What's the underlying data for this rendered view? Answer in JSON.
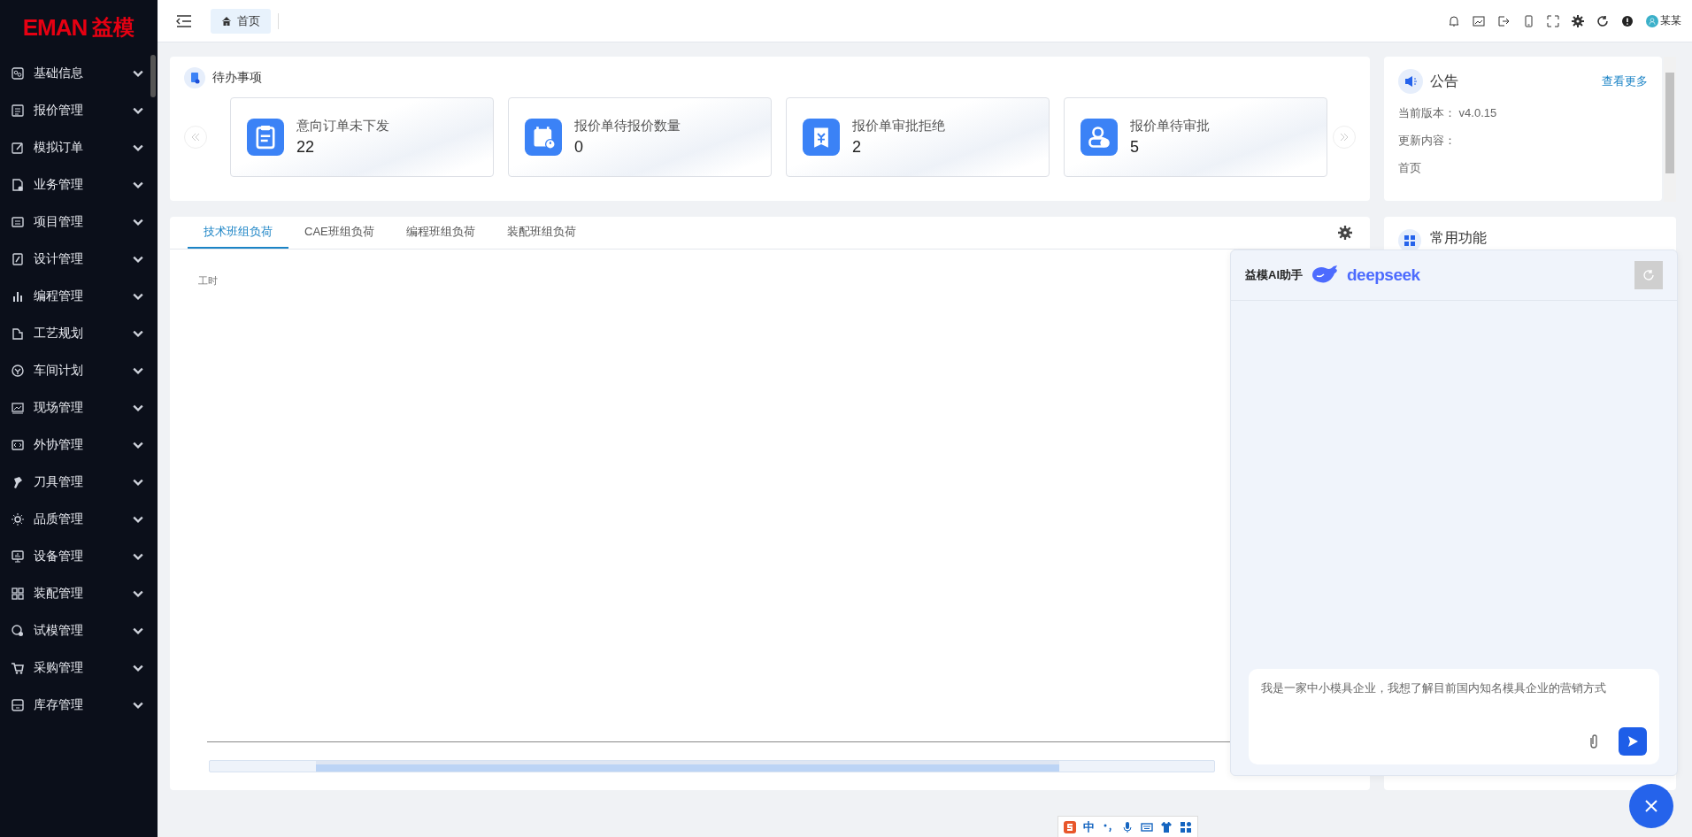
{
  "logo": {
    "latin": "EMAN",
    "cn": "益模"
  },
  "sidebar": {
    "items": [
      {
        "label": "基础信息"
      },
      {
        "label": "报价管理"
      },
      {
        "label": "模拟订单"
      },
      {
        "label": "业务管理"
      },
      {
        "label": "项目管理"
      },
      {
        "label": "设计管理"
      },
      {
        "label": "编程管理"
      },
      {
        "label": "工艺规划"
      },
      {
        "label": "车间计划"
      },
      {
        "label": "现场管理"
      },
      {
        "label": "外协管理"
      },
      {
        "label": "刀具管理"
      },
      {
        "label": "品质管理"
      },
      {
        "label": "设备管理"
      },
      {
        "label": "装配管理"
      },
      {
        "label": "试模管理"
      },
      {
        "label": "采购管理"
      },
      {
        "label": "库存管理"
      }
    ]
  },
  "topbar": {
    "page_tabs": [
      {
        "label": "首页",
        "selected": true
      }
    ],
    "user": "某某"
  },
  "todo": {
    "title": "待办事项",
    "cards": [
      {
        "title": "意向订单未下发",
        "count": "22"
      },
      {
        "title": "报价单待报价数量",
        "count": "0"
      },
      {
        "title": "报价单审批拒绝",
        "count": "2"
      },
      {
        "title": "报价单待审批",
        "count": "5"
      }
    ]
  },
  "notice": {
    "title": "公告",
    "more": "查看更多",
    "lines": [
      "当前版本： v4.0.15",
      "更新内容：",
      "首页"
    ]
  },
  "workload": {
    "tabs": [
      {
        "label": "技术班组负荷",
        "selected": true
      },
      {
        "label": "CAE班组负荷",
        "selected": false
      },
      {
        "label": "编程班组负荷",
        "selected": false
      },
      {
        "label": "装配班组负荷",
        "selected": false
      }
    ],
    "chart": {
      "ylabel": "工时"
    }
  },
  "shortcuts": {
    "title": "常用功能"
  },
  "assistant": {
    "title": "益模AI助手",
    "brand": "deepseek",
    "input": {
      "value": "我是一家中小模具企业，我想了解目前国内知名模具企业的营销方式"
    }
  },
  "ime": {
    "mode": "中"
  }
}
